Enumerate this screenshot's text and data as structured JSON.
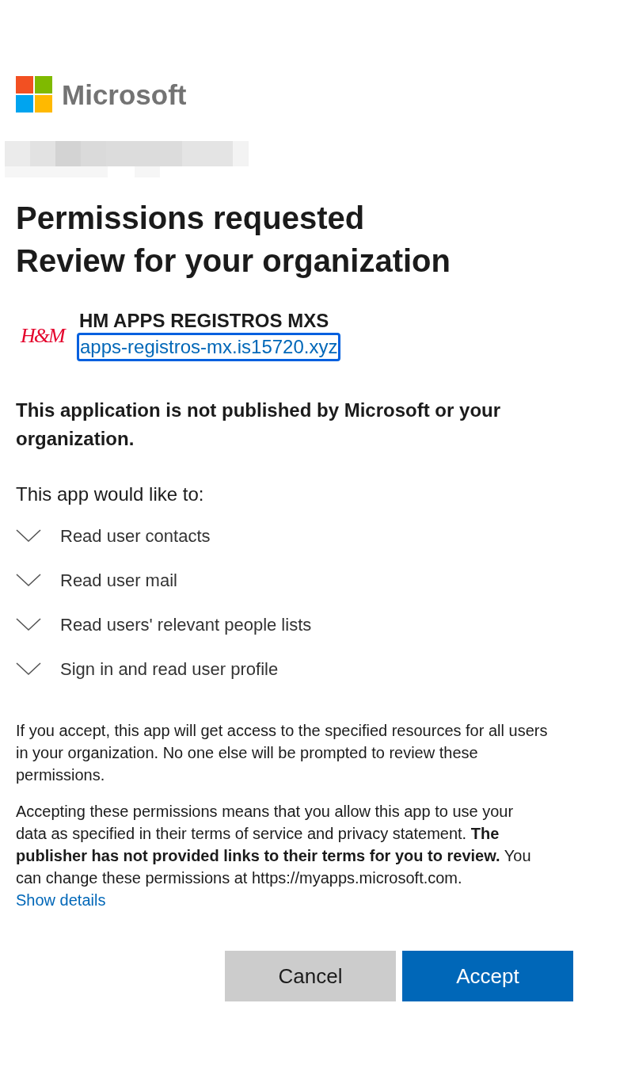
{
  "brand": {
    "name": "Microsoft"
  },
  "heading": [
    "Permissions requested",
    "Review for your organization"
  ],
  "app": {
    "logo": "H&M",
    "name": "HM APPS REGISTROS MXS",
    "link": "apps-registros-mx.is15720.xyz",
    "link_focused": true
  },
  "warning": "This application is not published by Microsoft or your organization.",
  "permissions_intro": "This app would like to:",
  "permissions": [
    {
      "label": "Read user contacts",
      "expanded": false
    },
    {
      "label": "Read user mail",
      "expanded": false
    },
    {
      "label": "Read users' relevant people lists",
      "expanded": false
    },
    {
      "label": "Sign in and read user profile",
      "expanded": false
    }
  ],
  "notice": "If you accept, this app will get access to the specified resources for all users in your organization. No one else will be prompted to review these permissions.",
  "consent": "Accepting these permissions means that you allow this app to use your data as specified in their terms of service and privacy statement. **The publisher has not provided links to their terms for you to review.** You can change these permissions at https://myapps.microsoft.com.",
  "details_link": "Show details",
  "buttons": [
    {
      "label": "Cancel",
      "kind": "secondary"
    },
    {
      "label": "Accept",
      "kind": "primary"
    }
  ]
}
